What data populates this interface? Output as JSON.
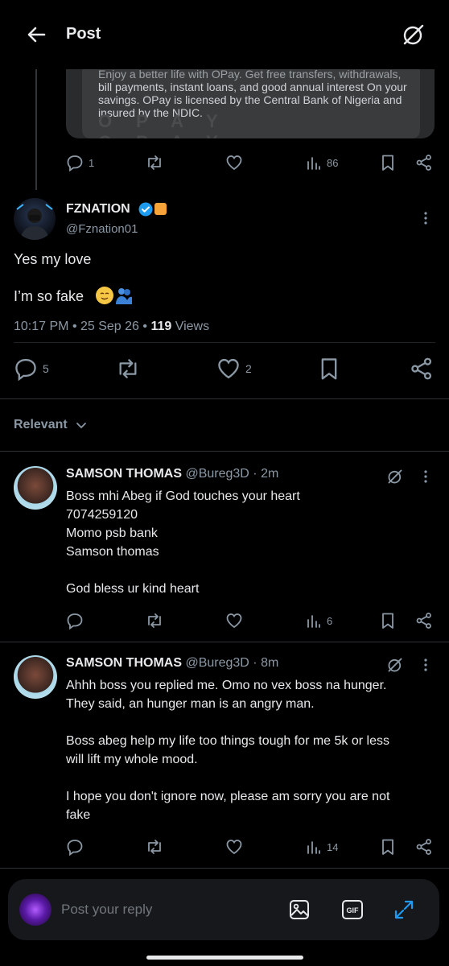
{
  "header": {
    "title": "Post",
    "back_icon": "arrow-left-icon",
    "grok_icon": "grok-icon"
  },
  "parent_post": {
    "ad_text_partial": "Enjoy a better life with OPay. Get free transfers, withdrawals,",
    "ad_text": "bill payments, instant loans, and good annual interest On your savings. OPay is licensed by the Central Bank of Nigeria and insured by the NDIC.",
    "watermark": "OPAY OPAY OPAY",
    "replies": "1",
    "views": "86"
  },
  "main_post": {
    "name": "FZNATION",
    "handle": "@Fznation01",
    "text_line1": "Yes my love",
    "text_line2": "I’m so fake",
    "time": "10:17 PM",
    "date": "25 Sep 26",
    "views_count": "119",
    "views_label": "Views",
    "replies": "5",
    "likes": "2"
  },
  "sort": {
    "label": "Relevant"
  },
  "replies": [
    {
      "name": "SAMSON THOMAS",
      "handle": "@Bureg3D",
      "time": "2m",
      "lines": [
        "Boss mhi Abeg if God touches your heart",
        "7074259120",
        "Momo psb bank",
        "Samson thomas",
        "",
        "God bless ur kind heart"
      ],
      "views": "6"
    },
    {
      "name": "SAMSON THOMAS",
      "handle": "@Bureg3D",
      "time": "8m",
      "lines": [
        "Ahhh boss you replied me. Omo no vex boss na hunger.",
        "They said, an hunger man is an angry man.",
        "",
        "Boss abeg help my life too things tough for me 5k or less",
        "will lift my whole mood.",
        "",
        "I hope you don't ignore now, please am sorry you are not",
        "fake"
      ],
      "views": "14"
    }
  ],
  "composer": {
    "placeholder": "Post your reply"
  },
  "colors": {
    "background": "#000000",
    "text": "#e7e9ea",
    "muted": "#8b98a5",
    "verified": "#1d9bf0",
    "affiliate": "#f6a33a"
  }
}
